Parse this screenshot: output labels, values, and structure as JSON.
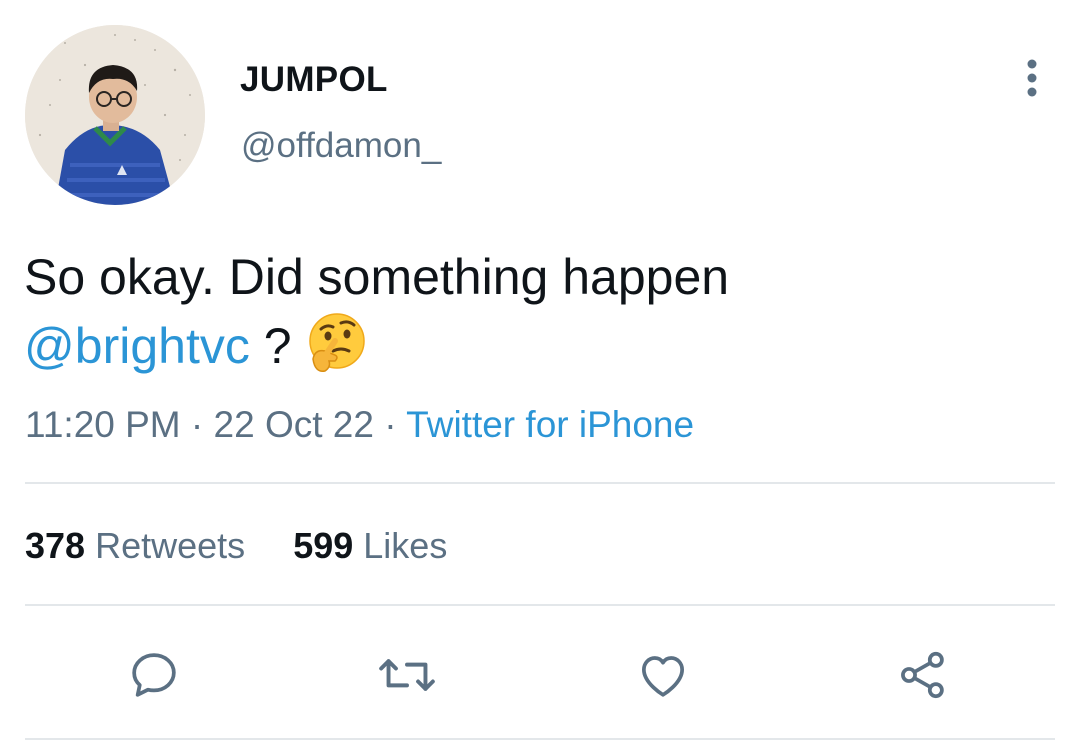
{
  "tweet": {
    "author": {
      "display_name": "JUMPOL",
      "handle": "@offdamon_"
    },
    "text": {
      "line1": "So okay. Did something happen",
      "mention": "@brightvc",
      "suffix": " ? ",
      "emoji": "thinking-face-emoji"
    },
    "meta": {
      "time": "11:20 PM",
      "sep1": " · ",
      "date": "22 Oct 22",
      "sep2": " · ",
      "source": "Twitter for iPhone"
    },
    "stats": {
      "retweets_count": "378",
      "retweets_label": "Retweets",
      "likes_count": "599",
      "likes_label": "Likes"
    },
    "actions": {
      "icons": [
        "reply-icon",
        "retweet-icon",
        "like-icon",
        "share-icon"
      ]
    }
  },
  "colors": {
    "link": "#2b95d6",
    "secondary_text": "#5b7083",
    "primary_text": "#0f1419",
    "divider": "#e3e7ea"
  }
}
